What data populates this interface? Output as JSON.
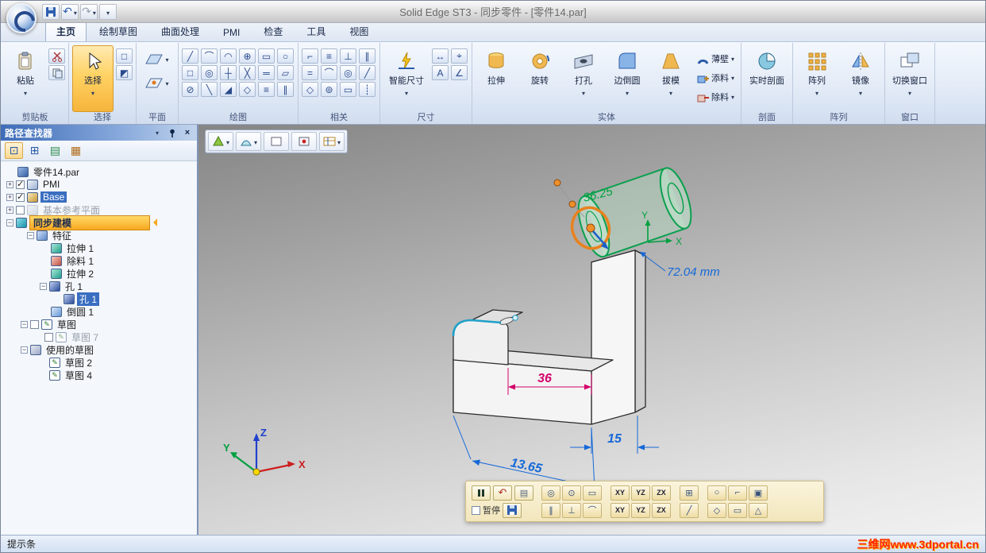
{
  "window": {
    "title": "Solid Edge ST3 - 同步零件 - [零件14.par]"
  },
  "ribbon": {
    "tabs": [
      "主页",
      "绘制草图",
      "曲面处理",
      "PMI",
      "检查",
      "工具",
      "视图"
    ],
    "clipboard": {
      "label": "剪贴板",
      "paste": "粘贴"
    },
    "select": {
      "label": "选择",
      "select": "选择",
      "tools": [
        "□",
        "◩"
      ]
    },
    "plane": {
      "label": "平面"
    },
    "draw": {
      "label": "绘图",
      "tools": [
        "╱",
        "⌒",
        "◠",
        "⊕",
        "▭",
        "○",
        "□",
        "◎",
        "┼",
        "╳",
        "═",
        "▱",
        "⊘",
        "╲",
        "◢",
        "◇",
        "≡",
        "∥"
      ]
    },
    "relate": {
      "label": "相关",
      "tools": [
        "⌐",
        "≡",
        "⊥",
        "∥",
        "=",
        "⌒",
        "◎",
        "╱",
        "◇",
        "⊚",
        "▭",
        "┊"
      ]
    },
    "dimension": {
      "label": "尺寸",
      "smart": "智能尺寸",
      "tools": [
        "↔",
        "⌖",
        "A",
        "∠"
      ]
    },
    "solid": {
      "label": "实体",
      "extrude": "拉伸",
      "revolve": "旋转",
      "hole": "打孔",
      "round": "边倒圆",
      "draft": "拔模",
      "thin": "薄壁",
      "add": "添料",
      "cut": "除料"
    },
    "section": {
      "label": "剖面",
      "live": "实时剖面"
    },
    "pattern": {
      "label": "阵列",
      "pattern": "阵列",
      "mirror": "镜像"
    },
    "win": {
      "label": "窗口",
      "switch": "切换窗口"
    }
  },
  "pathfinder": {
    "title": "路径查找器",
    "tree": [
      {
        "label": "零件14.par"
      },
      {
        "label": "PMI"
      },
      {
        "label": "Base"
      },
      {
        "label": "基本参考平面"
      },
      {
        "label": "同步建模"
      },
      {
        "label": "特征"
      },
      {
        "label": "拉伸 1"
      },
      {
        "label": "除料 1"
      },
      {
        "label": "拉伸 2"
      },
      {
        "label": "孔 1"
      },
      {
        "label": "孔 1"
      },
      {
        "label": "倒圆 1"
      },
      {
        "label": "草图"
      },
      {
        "label": "草图 7"
      },
      {
        "label": "使用的草图"
      },
      {
        "label": "草图 2"
      },
      {
        "label": "草图 4"
      }
    ]
  },
  "viewport": {
    "dims": {
      "cyl": "36.25",
      "leader": "72.04 mm",
      "width": "36",
      "depth": "15",
      "offset": "13.65"
    },
    "axes": {
      "x": "X",
      "y": "Y",
      "z": "Z"
    },
    "cmdbar": {
      "pause": "暂停"
    },
    "liverules": {
      "row1": [
        "◎",
        "⊙",
        "▭",
        "XY",
        "YZ",
        "ZX",
        "⊞",
        "○",
        "⌐",
        "▣"
      ],
      "row2": [
        "∥",
        "⊥",
        "⌒",
        "XY",
        "YZ",
        "ZX",
        "╱",
        "◇",
        "▭",
        "△"
      ]
    }
  },
  "statusbar": {
    "hint": "提示条",
    "watermark": "三维网www.3dportal.cn"
  }
}
